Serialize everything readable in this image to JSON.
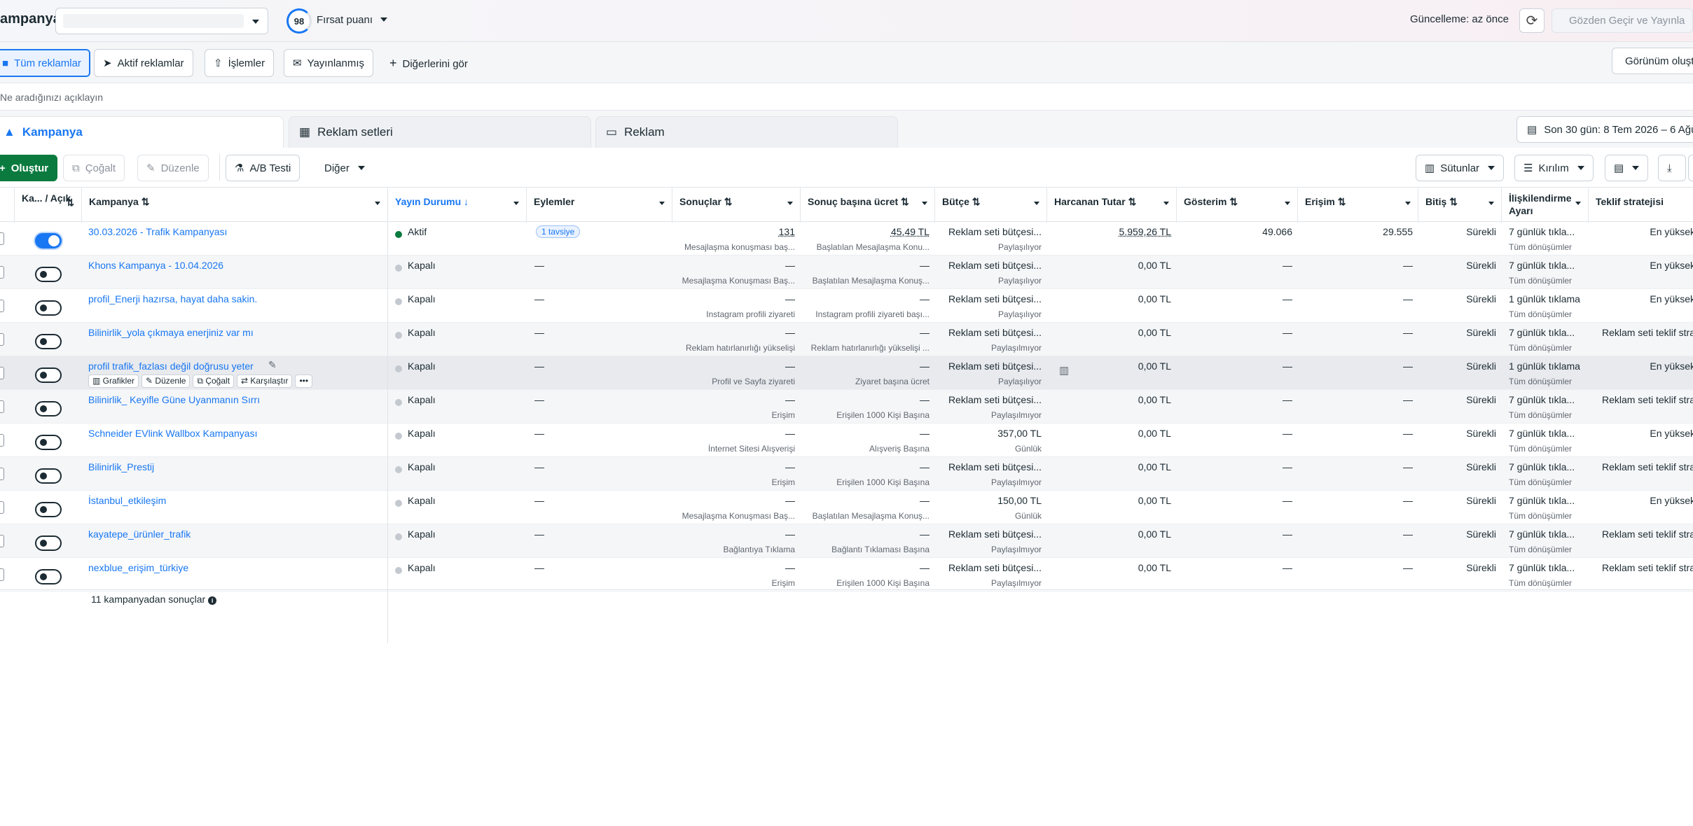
{
  "topbar": {
    "title": "ampanya",
    "opportunity_score": "98",
    "opportunity_label": "Fırsat puanı",
    "updated": "Güncelleme: az önce",
    "publish_label": "Gözden Geçir ve Yayınla"
  },
  "filters": {
    "all_ads": "Tüm reklamlar",
    "active_ads": "Aktif reklamlar",
    "actions": "İşlemler",
    "published": "Yayınlanmış",
    "see_more": "Diğerlerini gör",
    "view_button": "Görünüm oluşt"
  },
  "search": {
    "placeholder": "Ne aradığınızı açıklayın"
  },
  "tabs": {
    "campaigns": "Kampanya",
    "adsets": "Reklam setleri",
    "ads": "Reklam"
  },
  "date_range": "Son 30 gün: 8 Tem 2026 – 6 Ağu",
  "toolbar": {
    "create": "Oluştur",
    "duplicate": "Çoğalt",
    "edit": "Düzenle",
    "ab_test": "A/B Testi",
    "more": "Diğer",
    "columns": "Sütunlar",
    "breakdown": "Kırılım"
  },
  "columns": {
    "onoff": "Ka... / Açık",
    "name": "Kampanya",
    "delivery": "Yayın Durumu",
    "actions": "Eylemler",
    "results": "Sonuçlar",
    "cpr": "Sonuç başına ücret",
    "budget": "Bütçe",
    "spent": "Harcanan Tutar",
    "impressions": "Gösterim",
    "reach": "Erişim",
    "ends": "Bitiş",
    "attribution": "İlişkilendirme Ayarı",
    "bid": "Teklif stratejisi"
  },
  "row_actions": {
    "charts": "Grafikler",
    "edit": "Düzenle",
    "duplicate": "Çoğalt",
    "compare": "Karşılaştır",
    "more": "•••"
  },
  "rows": [
    {
      "name": "30.03.2026 - Trafik Kampanyası",
      "on": true,
      "status": "Aktif",
      "action": "1 tavsiye",
      "results": "131",
      "results_sub": "Mesajlaşma konuşması baş...",
      "cpr": "45,49 TL",
      "cpr_sub": "Başlatılan Mesajlaşma Konu...",
      "budget": "Reklam seti bütçesi...",
      "budget_sub": "Paylaşılıyor",
      "spent": "5.959,26 TL",
      "impressions": "49.066",
      "reach": "29.555",
      "ends": "Sürekli",
      "attr": "7 günlük tıkla...",
      "attr_sub": "Tüm dönüşümler",
      "bid": "En yüksek"
    },
    {
      "name": "Khons Kampanya - 10.04.2026",
      "on": false,
      "status": "Kapalı",
      "action": "—",
      "results": "—",
      "results_sub": "Mesajlaşma Konuşması Baş...",
      "cpr": "—",
      "cpr_sub": "Başlatılan Mesajlaşma Konuş...",
      "budget": "Reklam seti bütçesi...",
      "budget_sub": "Paylaşılıyor",
      "spent": "0,00 TL",
      "impressions": "—",
      "reach": "—",
      "ends": "Sürekli",
      "attr": "7 günlük tıkla...",
      "attr_sub": "Tüm dönüşümler",
      "bid": "En yüksek"
    },
    {
      "name": "profil_Enerji hazırsa, hayat daha sakin.",
      "on": false,
      "status": "Kapalı",
      "action": "—",
      "results": "—",
      "results_sub": "Instagram profili ziyareti",
      "cpr": "—",
      "cpr_sub": "Instagram profili ziyareti başı...",
      "budget": "Reklam seti bütçesi...",
      "budget_sub": "Paylaşılıyor",
      "spent": "0,00 TL",
      "impressions": "—",
      "reach": "—",
      "ends": "Sürekli",
      "attr": "1 günlük tıklama",
      "attr_sub": "Tüm dönüşümler",
      "bid": "En yüksek"
    },
    {
      "name": "Bilinirlik_yola çıkmaya enerjiniz var mı",
      "on": false,
      "status": "Kapalı",
      "action": "—",
      "results": "—",
      "results_sub": "Reklam hatırlanırlığı yükselişi",
      "cpr": "—",
      "cpr_sub": "Reklam hatırlanırlığı yükselişi ...",
      "budget": "Reklam seti bütçesi...",
      "budget_sub": "Paylaşılmıyor",
      "spent": "0,00 TL",
      "impressions": "—",
      "reach": "—",
      "ends": "Sürekli",
      "attr": "7 günlük tıkla...",
      "attr_sub": "Tüm dönüşümler",
      "bid": "Reklam seti teklif stra"
    },
    {
      "name": "profil trafik_fazlası değil doğrusu yeter",
      "on": false,
      "status": "Kapalı",
      "action": "—",
      "results": "—",
      "results_sub": "Profil ve Sayfa ziyareti",
      "cpr": "—",
      "cpr_sub": "Ziyaret başına ücret",
      "budget": "Reklam seti bütçesi...",
      "budget_sub": "Paylaşılıyor",
      "spent": "0,00 TL",
      "impressions": "—",
      "reach": "—",
      "ends": "Sürekli",
      "attr": "1 günlük tıklama",
      "attr_sub": "Tüm dönüşümler",
      "bid": "En yüksek",
      "hover": true
    },
    {
      "name": "Bilinirlik_ Keyifle Güne Uyanmanın Sırrı",
      "on": false,
      "status": "Kapalı",
      "action": "—",
      "results": "—",
      "results_sub": "Erişim",
      "cpr": "—",
      "cpr_sub": "Erişilen 1000 Kişi Başına",
      "budget": "Reklam seti bütçesi...",
      "budget_sub": "Paylaşılmıyor",
      "spent": "0,00 TL",
      "impressions": "—",
      "reach": "—",
      "ends": "Sürekli",
      "attr": "7 günlük tıkla...",
      "attr_sub": "Tüm dönüşümler",
      "bid": "Reklam seti teklif stra"
    },
    {
      "name": "Schneider EVlink Wallbox Kampanyası",
      "on": false,
      "status": "Kapalı",
      "action": "—",
      "results": "—",
      "results_sub": "İnternet Sitesi Alışverişi",
      "cpr": "—",
      "cpr_sub": "Alışveriş Başına",
      "budget": "357,00 TL",
      "budget_sub": "Günlük",
      "spent": "0,00 TL",
      "impressions": "—",
      "reach": "—",
      "ends": "Sürekli",
      "attr": "7 günlük tıkla...",
      "attr_sub": "Tüm dönüşümler",
      "bid": "En yüksek"
    },
    {
      "name": "Bilinirlik_Prestij",
      "on": false,
      "status": "Kapalı",
      "action": "—",
      "results": "—",
      "results_sub": "Erişim",
      "cpr": "—",
      "cpr_sub": "Erişilen 1000 Kişi Başına",
      "budget": "Reklam seti bütçesi...",
      "budget_sub": "Paylaşılmıyor",
      "spent": "0,00 TL",
      "impressions": "—",
      "reach": "—",
      "ends": "Sürekli",
      "attr": "7 günlük tıkla...",
      "attr_sub": "Tüm dönüşümler",
      "bid": "Reklam seti teklif stra"
    },
    {
      "name": "İstanbul_etkileşim",
      "on": false,
      "status": "Kapalı",
      "action": "—",
      "results": "—",
      "results_sub": "Mesajlaşma Konuşması Baş...",
      "cpr": "—",
      "cpr_sub": "Başlatılan Mesajlaşma Konuş...",
      "budget": "150,00 TL",
      "budget_sub": "Günlük",
      "spent": "0,00 TL",
      "impressions": "—",
      "reach": "—",
      "ends": "Sürekli",
      "attr": "7 günlük tıkla...",
      "attr_sub": "Tüm dönüşümler",
      "bid": "En yüksek"
    },
    {
      "name": "kayatepe_ürünler_trafik",
      "on": false,
      "status": "Kapalı",
      "action": "—",
      "results": "—",
      "results_sub": "Bağlantıya Tıklama",
      "cpr": "—",
      "cpr_sub": "Bağlantı Tıklaması Başına",
      "budget": "Reklam seti bütçesi...",
      "budget_sub": "Paylaşılmıyor",
      "spent": "0,00 TL",
      "impressions": "—",
      "reach": "—",
      "ends": "Sürekli",
      "attr": "7 günlük tıkla...",
      "attr_sub": "Tüm dönüşümler",
      "bid": "Reklam seti teklif stra"
    },
    {
      "name": "nexblue_erişim_türkiye",
      "on": false,
      "status": "Kapalı",
      "action": "—",
      "results": "—",
      "results_sub": "Erişim",
      "cpr": "—",
      "cpr_sub": "Erişilen 1000 Kişi Başına",
      "budget": "Reklam seti bütçesi...",
      "budget_sub": "Paylaşılmıyor",
      "spent": "0,00 TL",
      "impressions": "—",
      "reach": "—",
      "ends": "Sürekli",
      "attr": "7 günlük tıkla...",
      "attr_sub": "Tüm dönüşümler",
      "bid": "Reklam seti teklif stra"
    }
  ],
  "footer": "11 kampanyadan sonuçlar",
  "colors": {
    "accent": "#1877f2",
    "active_green": "#0a7a3e"
  }
}
